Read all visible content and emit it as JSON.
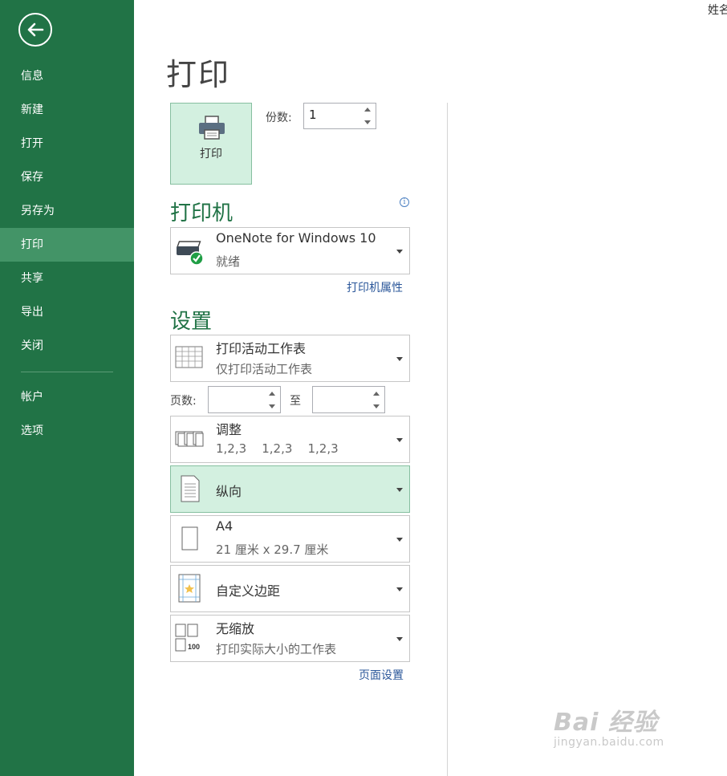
{
  "user": {
    "name": "姓名"
  },
  "sidebar": {
    "back_icon": "arrow-left-icon",
    "items": [
      {
        "label": "信息"
      },
      {
        "label": "新建"
      },
      {
        "label": "打开"
      },
      {
        "label": "保存"
      },
      {
        "label": "另存为"
      },
      {
        "label": "打印",
        "active": true
      },
      {
        "label": "共享"
      },
      {
        "label": "导出"
      },
      {
        "label": "关闭"
      },
      {
        "label": "帐户"
      },
      {
        "label": "选项"
      }
    ]
  },
  "main": {
    "title": "打印",
    "print_button_label": "打印",
    "copies_label": "份数:",
    "copies_value": "1",
    "printer_heading": "打印机",
    "printer": {
      "name": "OneNote for Windows 10",
      "status": "就绪"
    },
    "printer_properties_link": "打印机属性",
    "settings_heading": "设置",
    "settings": [
      {
        "main": "打印活动工作表",
        "sub": "仅打印活动工作表",
        "icon": "worksheet-grid-icon"
      },
      {
        "main": "调整",
        "sub": "1,2,3    1,2,3    1,2,3",
        "icon": "collate-icon"
      },
      {
        "main": "纵向",
        "sub": "",
        "icon": "portrait-orientation-icon",
        "selected": true
      },
      {
        "main": "A4",
        "sub": "21 厘米 x 29.7 厘米",
        "icon": "paper-size-icon"
      },
      {
        "main": "自定义边距",
        "sub": "",
        "icon": "custom-margins-icon"
      },
      {
        "main": "无缩放",
        "sub": "打印实际大小的工作表",
        "icon": "no-scaling-icon"
      }
    ],
    "pages_label": "页数:",
    "pages_from": "",
    "to_label": "至",
    "pages_to": "",
    "page_setup_link": "页面设置"
  },
  "watermark": {
    "main": "Bai 经验",
    "sub": "jingyan.baidu.com"
  },
  "colors": {
    "sidebar": "#217346",
    "sidebar_active": "#439467",
    "heading": "#217346",
    "selected": "#d3f0e0",
    "link": "#2b579a"
  }
}
